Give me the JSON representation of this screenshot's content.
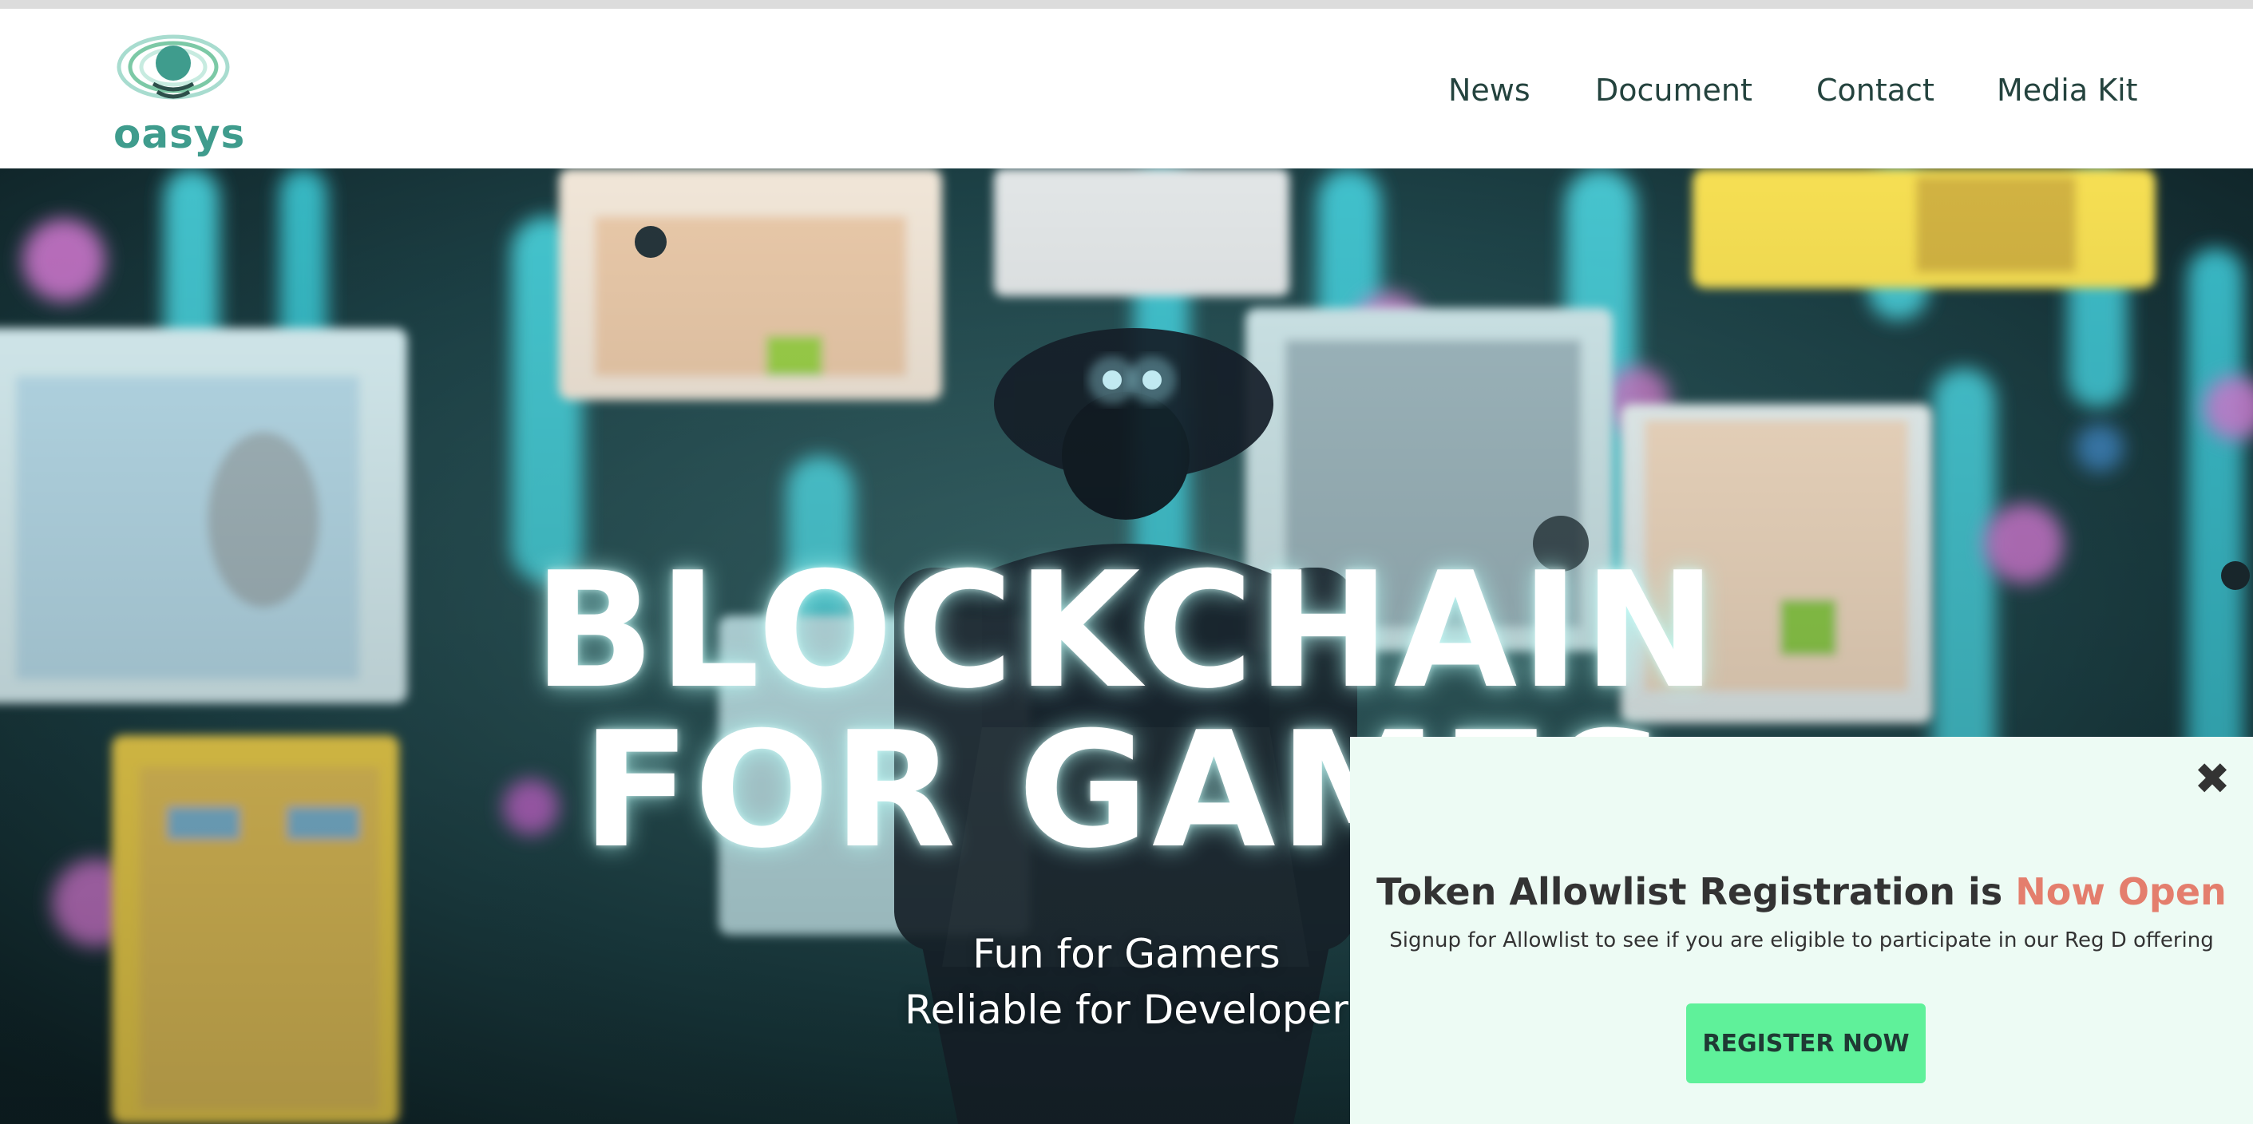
{
  "brand": {
    "name": "oasys",
    "color": "#3f9c8d"
  },
  "nav": {
    "items": [
      "News",
      "Document",
      "Contact",
      "Media Kit"
    ]
  },
  "hero": {
    "headline_line1": "BLOCKCHAIN",
    "headline_line2": "FOR GAMES",
    "sub_line1": "Fun for Gamers",
    "sub_line2": "Reliable for Developer"
  },
  "popup": {
    "close_icon": "close-icon",
    "title_prefix": "Token Allowlist Registration is ",
    "title_highlight": "Now Open",
    "subtitle": "Signup for Allowlist to see if you are eligible to participate in our Reg D offering",
    "button_label": "REGISTER NOW",
    "accent_color": "#e47e6d",
    "button_color": "#5ff19a",
    "background_color": "#edfbf4"
  }
}
